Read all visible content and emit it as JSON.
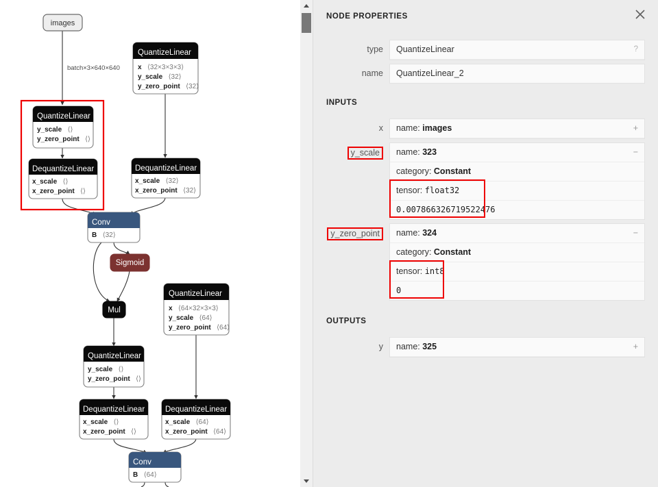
{
  "graph": {
    "input_node": {
      "label": "images"
    },
    "edge_labels": [
      {
        "text": "batch×3×640×640"
      }
    ],
    "nodes": [
      {
        "id": "quantizelinear-weights-1",
        "title": "QuantizeLinear",
        "header_color": "#0a0a0a",
        "attrs": [
          {
            "name": "x",
            "shape": "⟨32×3×3×3⟩"
          },
          {
            "name": "y_scale",
            "shape": "⟨32⟩"
          },
          {
            "name": "y_zero_point",
            "shape": "⟨32⟩"
          }
        ]
      },
      {
        "id": "quantizelinear-selected",
        "title": "QuantizeLinear",
        "header_color": "#0a0a0a",
        "attrs": [
          {
            "name": "y_scale",
            "shape": "⟨⟩"
          },
          {
            "name": "y_zero_point",
            "shape": "⟨⟩"
          }
        ]
      },
      {
        "id": "dequantizelinear-activation-1",
        "title": "DequantizeLinear",
        "header_color": "#0a0a0a",
        "attrs": [
          {
            "name": "x_scale",
            "shape": "⟨⟩"
          },
          {
            "name": "x_zero_point",
            "shape": "⟨⟩"
          }
        ]
      },
      {
        "id": "dequantizelinear-weights-1",
        "title": "DequantizeLinear",
        "header_color": "#0a0a0a",
        "attrs": [
          {
            "name": "x_scale",
            "shape": "⟨32⟩"
          },
          {
            "name": "x_zero_point",
            "shape": "⟨32⟩"
          }
        ]
      },
      {
        "id": "conv-1",
        "title": "Conv",
        "header_color": "#39577e",
        "attrs": [
          {
            "name": "B",
            "shape": "⟨32⟩"
          }
        ]
      },
      {
        "id": "sigmoid-1",
        "title": "Sigmoid",
        "header_color": "#7c3230",
        "attrs": []
      },
      {
        "id": "mul-1",
        "title": "Mul",
        "header_color": "#0a0a0a",
        "attrs": []
      },
      {
        "id": "quantizelinear-weights-2",
        "title": "QuantizeLinear",
        "header_color": "#0a0a0a",
        "attrs": [
          {
            "name": "x",
            "shape": "⟨64×32×3×3⟩"
          },
          {
            "name": "y_scale",
            "shape": "⟨64⟩"
          },
          {
            "name": "y_zero_point",
            "shape": "⟨64⟩"
          }
        ]
      },
      {
        "id": "quantizelinear-activation-2",
        "title": "QuantizeLinear",
        "header_color": "#0a0a0a",
        "attrs": [
          {
            "name": "y_scale",
            "shape": "⟨⟩"
          },
          {
            "name": "y_zero_point",
            "shape": "⟨⟩"
          }
        ]
      },
      {
        "id": "dequantizelinear-activation-2",
        "title": "DequantizeLinear",
        "header_color": "#0a0a0a",
        "attrs": [
          {
            "name": "x_scale",
            "shape": "⟨⟩"
          },
          {
            "name": "x_zero_point",
            "shape": "⟨⟩"
          }
        ]
      },
      {
        "id": "dequantizelinear-weights-2",
        "title": "DequantizeLinear",
        "header_color": "#0a0a0a",
        "attrs": [
          {
            "name": "x_scale",
            "shape": "⟨64⟩"
          },
          {
            "name": "x_zero_point",
            "shape": "⟨64⟩"
          }
        ]
      },
      {
        "id": "conv-2",
        "title": "Conv",
        "header_color": "#39577e",
        "attrs": [
          {
            "name": "B",
            "shape": "⟨64⟩"
          }
        ]
      }
    ],
    "highlight_color": "#ee0000"
  },
  "scrollbar": {
    "up_arrow": "triangle-up-icon",
    "down_arrow": "triangle-down-icon",
    "thumb": "scroll-thumb"
  },
  "panel": {
    "title": "NODE PROPERTIES",
    "close_icon": "close-icon",
    "help_sign": "?",
    "properties": [
      {
        "label": "type",
        "value": "QuantizeLinear",
        "help": "?"
      },
      {
        "label": "name",
        "value": "QuantizeLinear_2"
      }
    ],
    "inputs_heading": "INPUTS",
    "inputs": [
      {
        "label": "x",
        "label_boxed": false,
        "toggle": "+",
        "lines": [
          {
            "key": "name:",
            "value": "images",
            "bold": true
          }
        ]
      },
      {
        "label": "y_scale",
        "label_boxed": true,
        "toggle": "−",
        "lines": [
          {
            "key": "name:",
            "value": "323",
            "bold": true
          },
          {
            "key": "category:",
            "value": "Constant",
            "bold": true
          },
          {
            "key": "tensor:",
            "value": "float32",
            "mono": true,
            "boxed_start": true
          },
          {
            "value": "0.007866326719522476",
            "mono_only": true,
            "boxed_end": true
          }
        ]
      },
      {
        "label": "y_zero_point",
        "label_boxed": true,
        "toggle": "−",
        "lines": [
          {
            "key": "name:",
            "value": "324",
            "bold": true
          },
          {
            "key": "category:",
            "value": "Constant",
            "bold": true
          },
          {
            "key": "tensor:",
            "value": "int8",
            "mono": true,
            "boxed_start": true
          },
          {
            "value": "0",
            "mono_only": true,
            "boxed_end": true
          }
        ]
      }
    ],
    "outputs_heading": "OUTPUTS",
    "outputs": [
      {
        "label": "y",
        "label_boxed": false,
        "toggle": "+",
        "lines": [
          {
            "key": "name:",
            "value": "325",
            "bold": true
          }
        ]
      }
    ]
  }
}
